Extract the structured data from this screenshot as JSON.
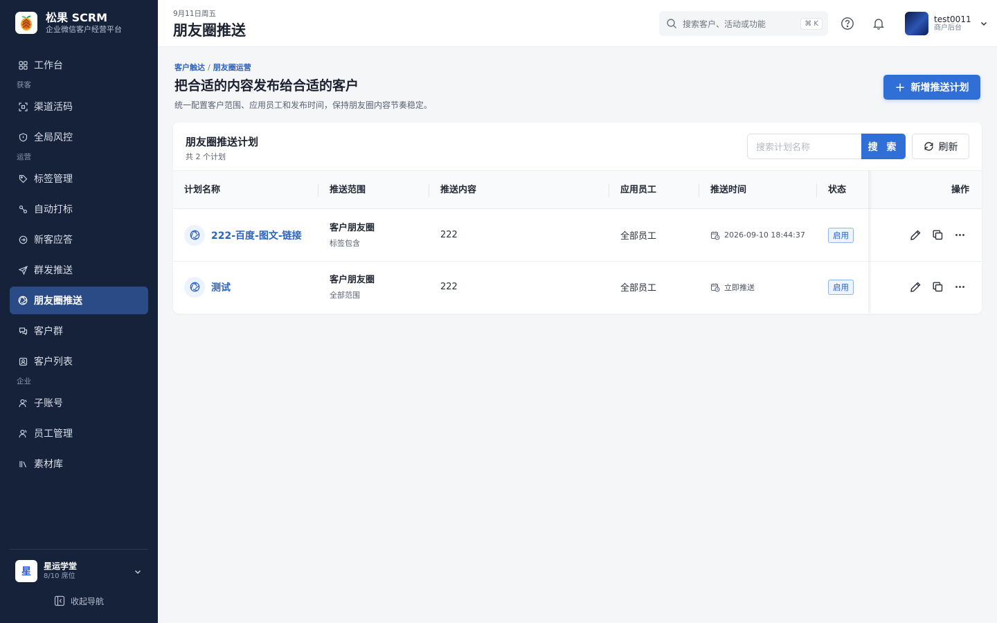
{
  "brand": {
    "title": "松果 SCRM",
    "subtitle": "企业微信客户经营平台",
    "logo": "pinecone-logo"
  },
  "sidebar": {
    "items": [
      {
        "label": "工作台",
        "icon": "dashboard-icon"
      },
      {
        "group": "获客"
      },
      {
        "label": "渠道活码",
        "icon": "qrcode-icon"
      },
      {
        "label": "全局风控",
        "icon": "shield-icon"
      },
      {
        "group": "运营"
      },
      {
        "label": "标签管理",
        "icon": "tag-icon"
      },
      {
        "label": "自动打标",
        "icon": "auto-tag-icon"
      },
      {
        "label": "新客应答",
        "icon": "reply-icon"
      },
      {
        "label": "群发推送",
        "icon": "send-icon"
      },
      {
        "label": "朋友圈推送",
        "icon": "moments-icon",
        "active": true
      },
      {
        "label": "客户群",
        "icon": "group-chat-icon"
      },
      {
        "label": "客户列表",
        "icon": "contacts-icon"
      },
      {
        "group": "企业"
      },
      {
        "label": "子账号",
        "icon": "sub-account-icon"
      },
      {
        "label": "员工管理",
        "icon": "staff-icon"
      },
      {
        "label": "素材库",
        "icon": "library-icon"
      }
    ],
    "tenant": {
      "avatar_text": "星",
      "name": "星运学堂",
      "seats": "8/10 席位"
    },
    "collapse_label": "收起导航"
  },
  "topbar": {
    "date": "9月11日周五",
    "title": "朋友圈推送",
    "search_placeholder": "搜索客户、活动或功能",
    "shortcut": "⌘ K",
    "user": {
      "name": "test0011",
      "role": "商户后台"
    }
  },
  "main": {
    "breadcrumb": [
      "客户触达",
      "朋友圈运营"
    ],
    "breadcrumb_sep": "/",
    "heading": "把合适的内容发布给合适的客户",
    "description": "统一配置客户范围、应用员工和发布时间，保持朋友圈内容节奏稳定。",
    "add_button": "新增推送计划"
  },
  "plans": {
    "title": "朋友圈推送计划",
    "count_label": "共 2 个计划",
    "search_placeholder": "搜索计划名称",
    "search_button": "搜 索",
    "refresh_button": "刷新",
    "columns": {
      "name": "计划名称",
      "scope": "推送范围",
      "content": "推送内容",
      "staff": "应用员工",
      "time": "推送时间",
      "status": "状态",
      "actions": "操作"
    },
    "rows": [
      {
        "name": "222-百度-图文-链接",
        "scope": "客户朋友圈",
        "scope_detail": "标签包含",
        "content": "222",
        "staff": "全部员工",
        "time": "2026-09-10 18:44:37",
        "status": "启用"
      },
      {
        "name": "测试",
        "scope": "客户朋友圈",
        "scope_detail": "全部范围",
        "content": "222",
        "staff": "全部员工",
        "time": "立即推送",
        "status": "启用"
      }
    ]
  },
  "colors": {
    "sidebar_bg": "#16213a",
    "accent": "#2f6fd6",
    "active_nav": "#2b4b86"
  }
}
